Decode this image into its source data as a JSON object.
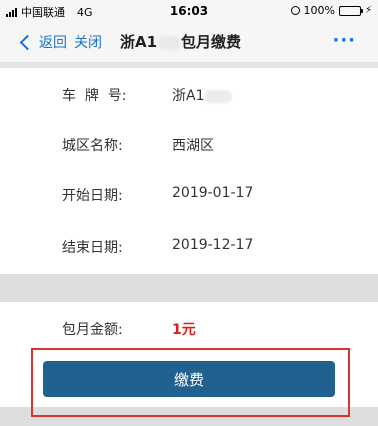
{
  "status_bar": {
    "carrier": "中国联通",
    "network": "4G",
    "time": "16:03",
    "battery": "100%",
    "battery_level": 1.0
  },
  "nav": {
    "back_label": "返回",
    "close_label": "关闭",
    "title_prefix": "浙A1",
    "title_suffix": "包月缴费",
    "more_label": "···"
  },
  "details": {
    "plate_label": "车  牌  号:",
    "plate_value": "浙A1",
    "district_label": "城区名称:",
    "district_value": "西湖区",
    "start_label": "开始日期:",
    "start_value": "2019-01-17",
    "end_label": "结束日期:",
    "end_value": "2019-12-17"
  },
  "payment": {
    "amount_label": "包月金额:",
    "amount_value": "1元",
    "pay_button_label": "缴费"
  },
  "colors": {
    "accent": "#1a73c9",
    "button": "#21618f",
    "amount": "#d81e1e",
    "highlight": "#d9342b"
  }
}
